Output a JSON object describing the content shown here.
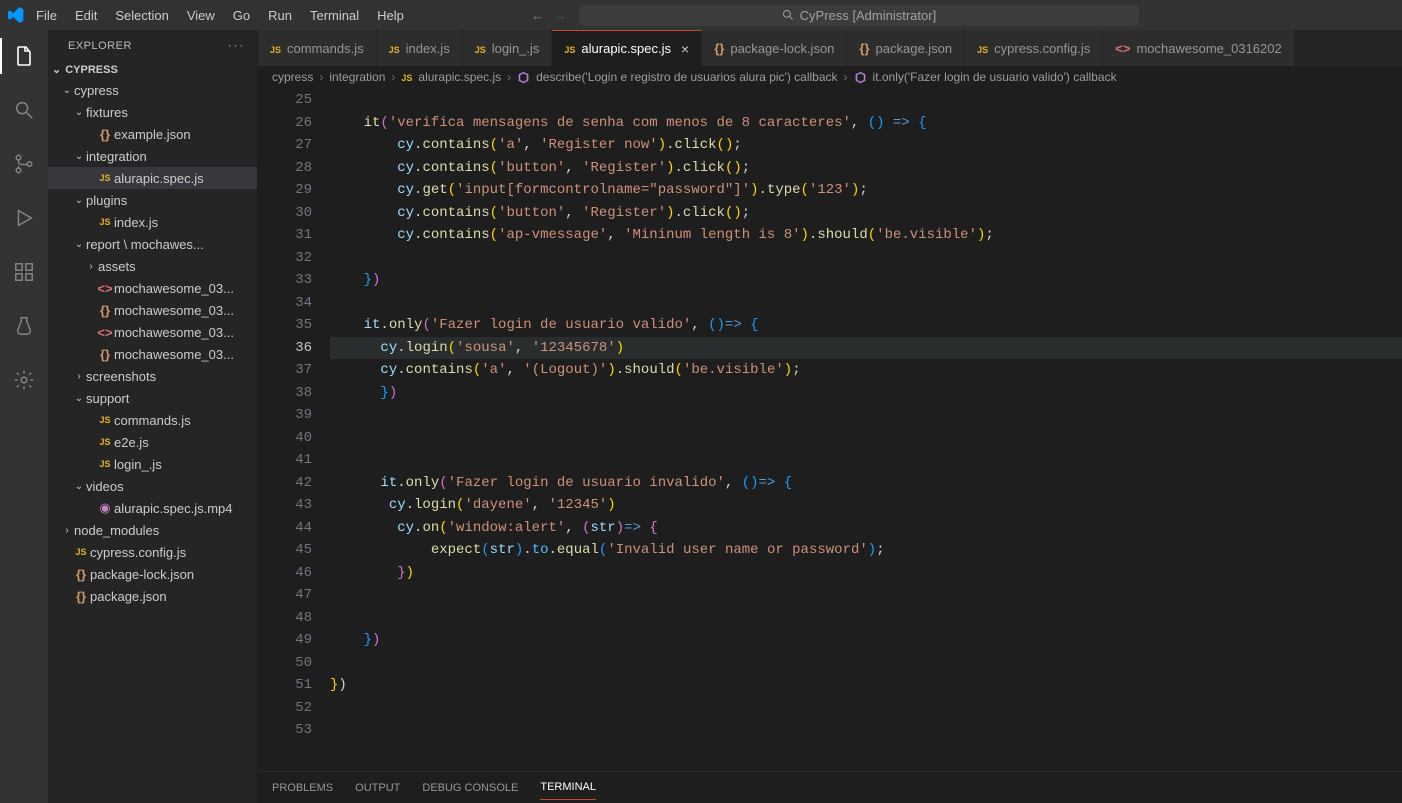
{
  "titlebar": {
    "menu": [
      "File",
      "Edit",
      "Selection",
      "View",
      "Go",
      "Run",
      "Terminal",
      "Help"
    ],
    "title": "CyPress [Administrator]"
  },
  "sidebar": {
    "explorer_label": "EXPLORER",
    "project_label": "CYPRESS",
    "tree": [
      {
        "depth": 1,
        "type": "folder",
        "open": true,
        "label": "cypress"
      },
      {
        "depth": 2,
        "type": "folder",
        "open": true,
        "label": "fixtures"
      },
      {
        "depth": 3,
        "type": "file",
        "icon": "json",
        "label": "example.json"
      },
      {
        "depth": 2,
        "type": "folder",
        "open": true,
        "label": "integration"
      },
      {
        "depth": 3,
        "type": "file",
        "icon": "js",
        "label": "alurapic.spec.js",
        "active": true
      },
      {
        "depth": 2,
        "type": "folder",
        "open": true,
        "label": "plugins"
      },
      {
        "depth": 3,
        "type": "file",
        "icon": "js",
        "label": "index.js"
      },
      {
        "depth": 2,
        "type": "folder",
        "open": true,
        "label": "report \\ mochawes..."
      },
      {
        "depth": 3,
        "type": "folder",
        "open": false,
        "label": "assets"
      },
      {
        "depth": 3,
        "type": "file",
        "icon": "html",
        "label": "mochawesome_03..."
      },
      {
        "depth": 3,
        "type": "file",
        "icon": "json",
        "label": "mochawesome_03..."
      },
      {
        "depth": 3,
        "type": "file",
        "icon": "html",
        "label": "mochawesome_03..."
      },
      {
        "depth": 3,
        "type": "file",
        "icon": "json",
        "label": "mochawesome_03..."
      },
      {
        "depth": 2,
        "type": "folder",
        "open": false,
        "label": "screenshots"
      },
      {
        "depth": 2,
        "type": "folder",
        "open": true,
        "label": "support"
      },
      {
        "depth": 3,
        "type": "file",
        "icon": "js",
        "label": "commands.js"
      },
      {
        "depth": 3,
        "type": "file",
        "icon": "js",
        "label": "e2e.js"
      },
      {
        "depth": 3,
        "type": "file",
        "icon": "js",
        "label": "login_.js"
      },
      {
        "depth": 2,
        "type": "folder",
        "open": true,
        "label": "videos"
      },
      {
        "depth": 3,
        "type": "file",
        "icon": "video",
        "label": "alurapic.spec.js.mp4"
      },
      {
        "depth": 1,
        "type": "folder",
        "open": false,
        "label": "node_modules"
      },
      {
        "depth": 1,
        "type": "file",
        "icon": "js",
        "label": "cypress.config.js"
      },
      {
        "depth": 1,
        "type": "file",
        "icon": "json",
        "label": "package-lock.json"
      },
      {
        "depth": 1,
        "type": "file",
        "icon": "json",
        "label": "package.json"
      }
    ]
  },
  "tabs": [
    {
      "icon": "js",
      "label": "commands.js"
    },
    {
      "icon": "js",
      "label": "index.js"
    },
    {
      "icon": "js",
      "label": "login_.js"
    },
    {
      "icon": "js",
      "label": "alurapic.spec.js",
      "active": true,
      "close": true
    },
    {
      "icon": "json",
      "label": "package-lock.json"
    },
    {
      "icon": "json",
      "label": "package.json"
    },
    {
      "icon": "js",
      "label": "cypress.config.js"
    },
    {
      "icon": "html",
      "label": "mochawesome_0316202"
    }
  ],
  "breadcrumb": {
    "parts": [
      "cypress",
      "integration"
    ],
    "file": {
      "icon": "js",
      "label": "alurapic.spec.js"
    },
    "symbols": [
      "describe('Login e registro de usuarios alura pic') callback",
      "it.only('Fazer login de usuario valido') callback"
    ]
  },
  "gutter": {
    "start": 25,
    "count": 29,
    "active": 36
  },
  "panel_tabs": [
    "PROBLEMS",
    "OUTPUT",
    "DEBUG CONSOLE",
    "TERMINAL"
  ],
  "panel_active": 3
}
